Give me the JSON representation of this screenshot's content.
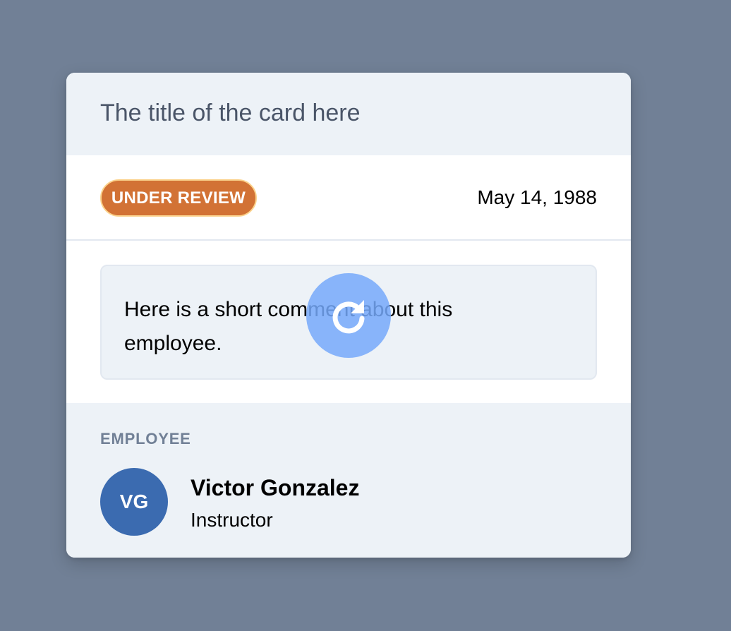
{
  "card": {
    "title": "The title of the card here",
    "status": {
      "badge_label": "UNDER REVIEW",
      "badge_color": "#d27235",
      "date": "May 14, 1988"
    },
    "comment": {
      "text": "Here is a short comment about this employee."
    },
    "overlay": {
      "icon": "refresh-icon",
      "color": "#76a9fa"
    },
    "employee": {
      "section_label": "EMPLOYEE",
      "initials": "VG",
      "name": "Victor Gonzalez",
      "role": "Instructor",
      "avatar_color": "#3b6bb0"
    }
  }
}
